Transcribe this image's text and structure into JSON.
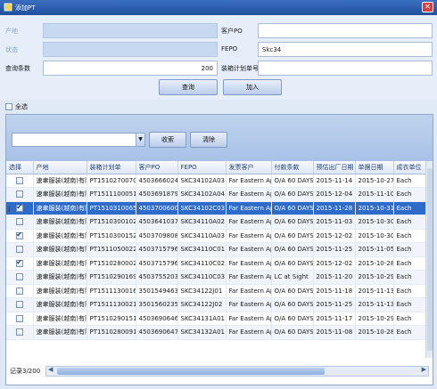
{
  "window": {
    "title": "添加PT"
  },
  "form": {
    "producer_label": "产地",
    "customer_po_label": "客户PO",
    "customer_po_value": "",
    "status_label": "状态",
    "fepo_label": "FEPO",
    "fepo_value": "Skc34",
    "query_count_label": "查询条数",
    "query_count_value": "200",
    "plan_no_label": "装箱计划单号",
    "plan_no_value": "",
    "query_button": "查询",
    "add_button": "加入"
  },
  "select_all_label": "全选",
  "search": {
    "value": "",
    "search_button": "收索",
    "clear_button": "清除"
  },
  "table": {
    "columns": [
      "选择",
      "产地",
      "装箱计划单",
      "客户PO",
      "FEPO",
      "发票客户",
      "付款条款",
      "预估出厂日期",
      "单据日期",
      "成衣单位"
    ],
    "rows": [
      {
        "checked": false,
        "selected": false,
        "cells": [
          "速聿服装(越南)有限...",
          "PT1510270070",
          "4503666024",
          "SKC34102A03",
          "Far Eastern Appa...",
          "O/A 60 DAYS ...",
          "2015-11-14",
          "2015-10-27",
          "Each"
        ]
      },
      {
        "checked": false,
        "selected": false,
        "cells": [
          "速聿服装(越南)有限...",
          "PT1511100051",
          "4503691879",
          "SKC34102A04",
          "Far Eastern Appa...",
          "O/A 60 DAYS ...",
          "2015-12-04",
          "2015-11-10",
          "Each"
        ]
      },
      {
        "checked": true,
        "selected": true,
        "cells": [
          "速聿服装(越南)有限...",
          "PT1510310065",
          "4503700600",
          "SKC34102C03",
          "Far Eastern Appa...",
          "O/A 60 DAYS ...",
          "2015-11-28",
          "2015-10-31",
          "Each"
        ]
      },
      {
        "checked": false,
        "selected": false,
        "cells": [
          "速聿服装(越南)有限...",
          "PT1510300102",
          "4503641037",
          "SKC34110A02",
          "Far Eastern Appa...",
          "O/A 60 DAYS ...",
          "2015-11-03",
          "2015-10-30",
          "Each"
        ]
      },
      {
        "checked": true,
        "selected": false,
        "cells": [
          "速聿服装(越南)有限...",
          "PT1510300152",
          "4503709808",
          "SKC34110A03",
          "Far Eastern Appa...",
          "O/A 60 DAYS ...",
          "2015-12-02",
          "2015-10-30",
          "Each"
        ]
      },
      {
        "checked": false,
        "selected": false,
        "cells": [
          "速聿服装(越南)有限...",
          "PT1511050022",
          "4503715796",
          "SKC34110C01",
          "Far Eastern Appa...",
          "O/A 60 DAYS ...",
          "2015-11-25",
          "2015-11-05",
          "Each"
        ]
      },
      {
        "checked": true,
        "selected": false,
        "cells": [
          "速聿服装(越南)有限...",
          "PT1510280002",
          "4503715796",
          "SKC34110C02",
          "Far Eastern Appa...",
          "O/A 60 DAYS ...",
          "2015-12-02",
          "2015-10-28",
          "Each"
        ]
      },
      {
        "checked": false,
        "selected": false,
        "cells": [
          "速聿服装(越南)有限...",
          "PT1510290169",
          "4503755203",
          "SKC34110C03",
          "Far Eastern Appa...",
          "LC at Sight",
          "2015-11-20",
          "2015-10-29",
          "Each"
        ]
      },
      {
        "checked": false,
        "selected": false,
        "cells": [
          "速聿服装(越南)有限...",
          "PT1511130016",
          "3501549463",
          "SKC34122J01",
          "Far Eastern Appa...",
          "O/A 60 DAYS ...",
          "2015-11-18",
          "2015-11-13",
          "Each"
        ]
      },
      {
        "checked": false,
        "selected": false,
        "cells": [
          "速聿服装(越南)有限...",
          "PT1511130021",
          "3501560235",
          "SKC34122J02",
          "Far Eastern Appa...",
          "O/A 60 DAYS ...",
          "2015-11-25",
          "2015-11-13",
          "Each"
        ]
      },
      {
        "checked": false,
        "selected": false,
        "cells": [
          "速聿服装(越南)有限...",
          "PT1510290151",
          "4503690646",
          "SKC34131A01",
          "Far Eastern Appa...",
          "O/A 60 DAYS ...",
          "2015-11-17",
          "2015-10-29",
          "Each"
        ]
      },
      {
        "checked": false,
        "selected": false,
        "cells": [
          "速聿服装(越南)有限...",
          "PT1510280091",
          "4503690647",
          "SKC34132A01",
          "Far Eastern Appa...",
          "O/A 60 DAYS ...",
          "2015-11-08",
          "2015-10-28",
          "Each"
        ]
      }
    ]
  },
  "status": {
    "record_text": "记录3/200"
  }
}
